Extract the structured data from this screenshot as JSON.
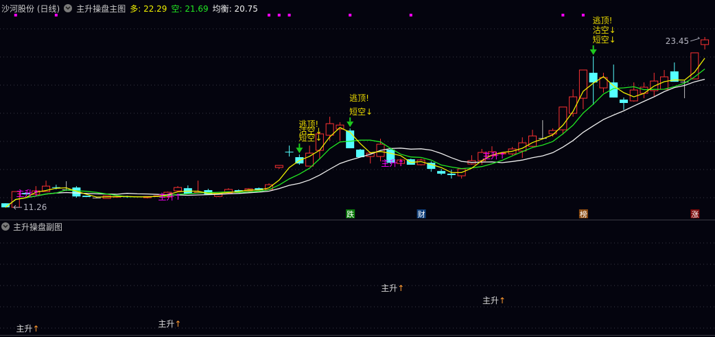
{
  "header": {
    "stock_title": "沙河股份 (日线)",
    "indicator_name": "主升操盘主图",
    "values": [
      {
        "label": "多",
        "value": "22.29",
        "color": "#f0f000"
      },
      {
        "label": "空",
        "value": "21.69",
        "color": "#22e822"
      },
      {
        "label": "均衡",
        "value": "20.75",
        "color": "#f0f0f0"
      }
    ]
  },
  "sub_panel": {
    "indicator_name": "主升操盘副图"
  },
  "colors": {
    "up": "#ff3232",
    "down": "#54ffff",
    "doji": "#c0c0c0",
    "ma_fast": "#f0f000",
    "ma_mid": "#22e822",
    "ma_slow": "#f0f0f0",
    "signal": "#ff00ff",
    "background": "#04040e"
  },
  "chart_data": {
    "type": "candlestick",
    "ylim": [
      10.38,
      26.1
    ],
    "price_labels": {
      "high": "23.45",
      "low": "11.26",
      "high_index": 69,
      "low_index": 0
    },
    "ohlc": [
      [
        11.55,
        11.55,
        11.26,
        11.26
      ],
      [
        11.26,
        12.39,
        11.26,
        12.39
      ],
      [
        12.29,
        12.34,
        12.19,
        12.19
      ],
      [
        12.19,
        12.78,
        12.19,
        12.44
      ],
      [
        12.39,
        13.17,
        12.39,
        12.78
      ],
      [
        12.7,
        12.88,
        12.54,
        12.66
      ],
      [
        12.54,
        13.13,
        12.44,
        12.54
      ],
      [
        12.68,
        12.78,
        11.95,
        12.04
      ],
      [
        12.09,
        12.09,
        12.0,
        12.0
      ],
      [
        11.95,
        12.0,
        11.9,
        11.95
      ],
      [
        11.9,
        12.09,
        11.9,
        12.09
      ],
      [
        12.0,
        12.04,
        11.95,
        12.04
      ],
      [
        12.04,
        12.09,
        11.95,
        12.0
      ],
      [
        12.04,
        12.04,
        12.0,
        12.0
      ],
      [
        11.95,
        12.04,
        11.9,
        12.04
      ],
      [
        12.04,
        12.09,
        12.0,
        12.09
      ],
      [
        12.0,
        12.39,
        11.95,
        12.34
      ],
      [
        12.44,
        12.78,
        12.39,
        12.68
      ],
      [
        12.63,
        12.83,
        12.24,
        12.24
      ],
      [
        12.29,
        13.17,
        12.24,
        12.34
      ],
      [
        12.49,
        12.59,
        12.19,
        12.19
      ],
      [
        12.04,
        12.24,
        12.0,
        12.24
      ],
      [
        12.29,
        12.63,
        12.24,
        12.54
      ],
      [
        12.49,
        12.54,
        12.39,
        12.39
      ],
      [
        12.44,
        12.63,
        12.39,
        12.59
      ],
      [
        12.63,
        12.68,
        12.49,
        12.49
      ],
      [
        12.54,
        12.98,
        12.54,
        12.88
      ],
      [
        14.11,
        14.26,
        14.01,
        14.26
      ],
      [
        15.24,
        15.68,
        14.9,
        15.19
      ],
      [
        14.85,
        15.04,
        14.31,
        14.4
      ],
      [
        14.21,
        15.68,
        14.21,
        15.14
      ],
      [
        15.34,
        16.67,
        14.7,
        16.52
      ],
      [
        16.42,
        17.75,
        16.03,
        17.25
      ],
      [
        16.86,
        17.35,
        16.03,
        17.15
      ],
      [
        16.76,
        16.91,
        15.49,
        15.49
      ],
      [
        15.39,
        15.44,
        14.85,
        14.85
      ],
      [
        14.9,
        15.24,
        14.4,
        15.14
      ],
      [
        14.9,
        16.17,
        14.55,
        15.78
      ],
      [
        15.39,
        15.53,
        14.36,
        14.45
      ],
      [
        14.4,
        14.75,
        14.21,
        14.65
      ],
      [
        14.7,
        14.75,
        14.31,
        14.31
      ],
      [
        14.31,
        14.75,
        14.26,
        14.65
      ],
      [
        14.45,
        14.55,
        13.81,
        14.01
      ],
      [
        13.86,
        14.01,
        13.57,
        13.67
      ],
      [
        13.67,
        13.96,
        13.32,
        13.57
      ],
      [
        13.52,
        14.01,
        13.32,
        14.01
      ],
      [
        14.36,
        14.99,
        14.31,
        14.6
      ],
      [
        14.6,
        15.44,
        14.31,
        15.19
      ],
      [
        14.95,
        15.63,
        14.9,
        15.24
      ],
      [
        15.09,
        15.14,
        15.04,
        15.14
      ],
      [
        15.09,
        15.58,
        14.99,
        15.44
      ],
      [
        15.29,
        16.27,
        14.8,
        15.88
      ],
      [
        15.63,
        16.81,
        15.58,
        16.37
      ],
      [
        16.22,
        17.5,
        16.17,
        16.22
      ],
      [
        16.52,
        16.91,
        16.32,
        16.76
      ],
      [
        16.81,
        18.44,
        16.47,
        18.44
      ],
      [
        17.99,
        19.71,
        17.75,
        19.17
      ],
      [
        19.07,
        21.09,
        18.29,
        21.09
      ],
      [
        20.89,
        22.07,
        18.59,
        20.2
      ],
      [
        19.81,
        20.89,
        19.47,
        20.55
      ],
      [
        20.2,
        21.48,
        19.12,
        19.12
      ],
      [
        18.97,
        19.12,
        18.24,
        18.73
      ],
      [
        18.88,
        20.2,
        18.83,
        19.66
      ],
      [
        19.42,
        20.2,
        19.07,
        19.86
      ],
      [
        19.61,
        20.89,
        19.22,
        20.3
      ],
      [
        19.71,
        21.09,
        19.71,
        20.6
      ],
      [
        20.99,
        21.63,
        20.25,
        20.25
      ],
      [
        20.25,
        20.35,
        19.07,
        20.25
      ],
      [
        20.45,
        22.32,
        20.45,
        22.32
      ],
      [
        22.91,
        23.45,
        22.56,
        23.25
      ]
    ],
    "ma_series": [
      {
        "name": "多",
        "period": 3
      },
      {
        "name": "空",
        "period": 6
      },
      {
        "name": "均衡",
        "period": 12
      }
    ],
    "top_markers": [
      1,
      5,
      26,
      27,
      28,
      34,
      40,
      55,
      57
    ],
    "main_signals": [
      {
        "index": 2,
        "text": "主升↑"
      },
      {
        "index": 16,
        "text": "主升↑"
      },
      {
        "index": 38,
        "text": "主升↑"
      },
      {
        "index": 48,
        "text": "主升↑"
      }
    ],
    "sell_signals": [
      {
        "index": 29,
        "lines": [
          "逃顶!",
          "沽空↓",
          "短空↓"
        ]
      },
      {
        "index": 34,
        "lines": [
          "逃顶!",
          "短空↓"
        ]
      },
      {
        "index": 58,
        "lines": [
          "逃顶!",
          "沽空↓",
          "短空↓"
        ]
      }
    ],
    "event_badges": [
      {
        "index": 34,
        "text": "跌",
        "color": "#0a7a0a"
      },
      {
        "index": 41,
        "text": "财",
        "color": "#0c3c78"
      },
      {
        "index": 57,
        "text": "榜",
        "color": "#8a4a10"
      },
      {
        "index": 68,
        "text": "涨",
        "color": "#7a0a0a"
      }
    ],
    "sub_signals": [
      {
        "index": 2,
        "text": "主升↑",
        "level": 3
      },
      {
        "index": 16,
        "text": "主升↑",
        "level": 8
      },
      {
        "index": 38,
        "text": "主升↑",
        "level": 45
      },
      {
        "index": 48,
        "text": "主升↑",
        "level": 32
      }
    ]
  }
}
